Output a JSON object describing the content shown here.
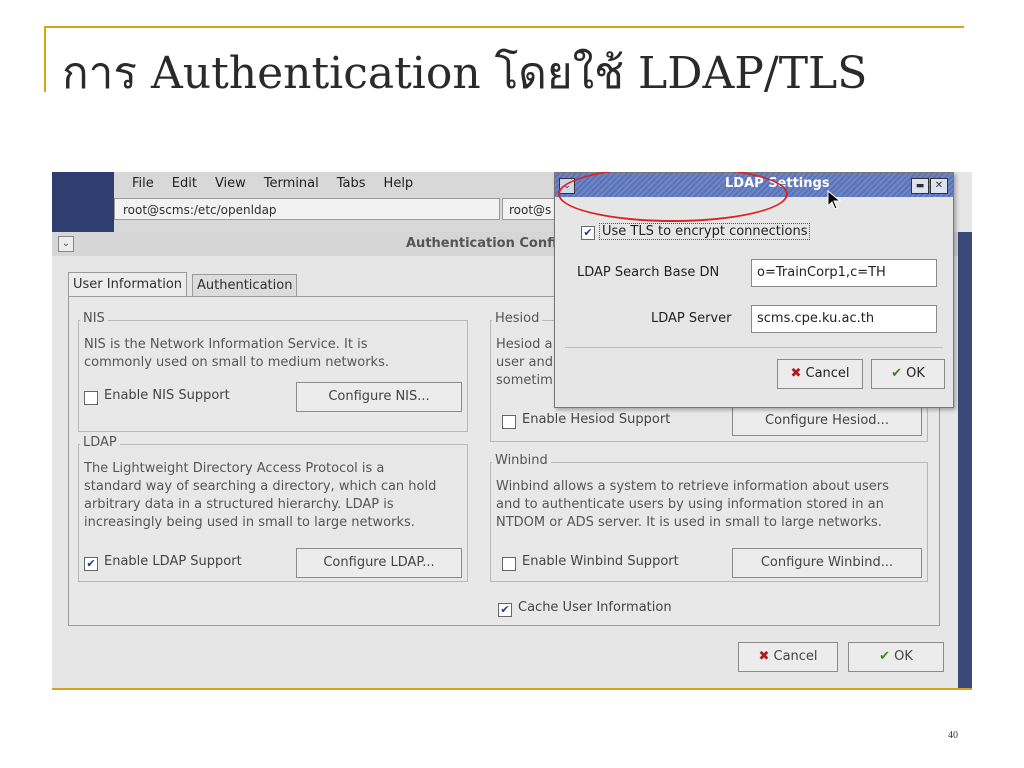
{
  "slide": {
    "title": "การ Authentication โดยใช้ LDAP/TLS",
    "page_number": "40"
  },
  "terminal": {
    "menu": [
      "File",
      "Edit",
      "View",
      "Terminal",
      "Tabs",
      "Help"
    ],
    "tab1": "root@scms:/etc/openldap",
    "tab2": "root@s"
  },
  "auth_window": {
    "title": "Authentication Confi",
    "tabs": [
      "User Information",
      "Authentication"
    ],
    "nis": {
      "label": "NIS",
      "desc1": "NIS is the Network Information Service.  It is",
      "desc2": "commonly used on small to medium networks.",
      "checkbox": "Enable NIS Support",
      "checked": false,
      "button": "Configure NIS..."
    },
    "ldap": {
      "label": "LDAP",
      "desc1": "The Lightweight Directory Access Protocol is a",
      "desc2": "standard way of searching a directory, which can hold",
      "desc3": "arbitrary data in a structured hierarchy.  LDAP is",
      "desc4": "increasingly being used in small to large networks.",
      "checkbox": "Enable LDAP Support",
      "checked": true,
      "button": "Configure LDAP..."
    },
    "hesiod": {
      "label": "Hesiod",
      "desc1": "Hesiod a",
      "desc2": "user and",
      "desc3": "sometim",
      "checkbox": "Enable Hesiod Support",
      "checked": false,
      "button": "Configure Hesiod..."
    },
    "winbind": {
      "label": "Winbind",
      "desc1": "Winbind allows a system to retrieve information about users",
      "desc2": "and to authenticate users by using information stored in an",
      "desc3": "NTDOM or ADS server.  It is used in small to large networks.",
      "checkbox": "Enable Winbind Support",
      "checked": false,
      "button": "Configure Winbind..."
    },
    "cache": {
      "label": "Cache User Information",
      "checked": true
    },
    "cancel": "Cancel",
    "ok": "OK"
  },
  "ldap_dialog": {
    "title": "LDAP Settings",
    "tls_label": "Use TLS to encrypt connections",
    "tls_checked": true,
    "base_dn_label": "LDAP Search Base DN",
    "base_dn_value": "o=TrainCorp1,c=TH",
    "server_label": "LDAP Server",
    "server_value": "scms.cpe.ku.ac.th",
    "cancel": "Cancel",
    "ok": "OK"
  },
  "colors": {
    "accent_rule": "#d9a21b",
    "highlight": "#dd2222",
    "titlebar": "#5a72b8"
  }
}
